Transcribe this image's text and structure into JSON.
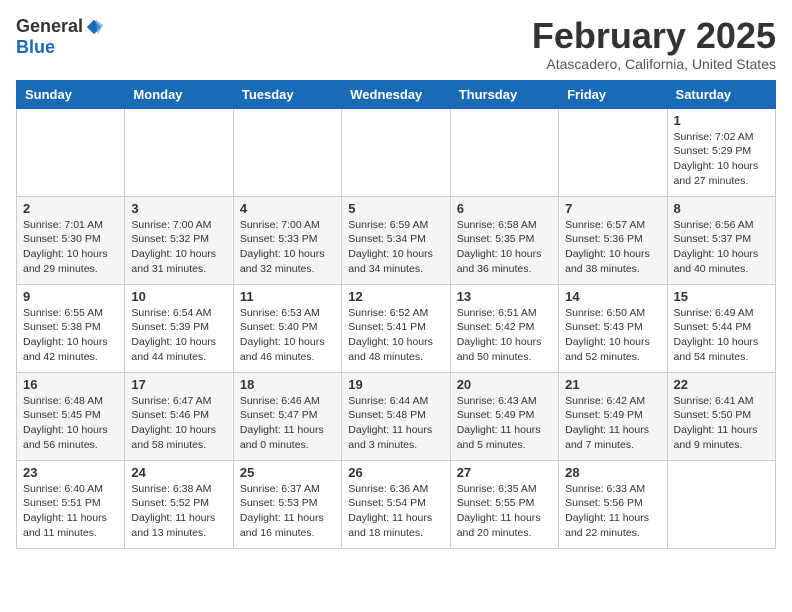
{
  "header": {
    "logo": {
      "general": "General",
      "blue": "Blue"
    },
    "title": "February 2025",
    "location": "Atascadero, California, United States"
  },
  "weekdays": [
    "Sunday",
    "Monday",
    "Tuesday",
    "Wednesday",
    "Thursday",
    "Friday",
    "Saturday"
  ],
  "weeks": [
    [
      {
        "day": "",
        "info": ""
      },
      {
        "day": "",
        "info": ""
      },
      {
        "day": "",
        "info": ""
      },
      {
        "day": "",
        "info": ""
      },
      {
        "day": "",
        "info": ""
      },
      {
        "day": "",
        "info": ""
      },
      {
        "day": "1",
        "info": "Sunrise: 7:02 AM\nSunset: 5:29 PM\nDaylight: 10 hours and 27 minutes."
      }
    ],
    [
      {
        "day": "2",
        "info": "Sunrise: 7:01 AM\nSunset: 5:30 PM\nDaylight: 10 hours and 29 minutes."
      },
      {
        "day": "3",
        "info": "Sunrise: 7:00 AM\nSunset: 5:32 PM\nDaylight: 10 hours and 31 minutes."
      },
      {
        "day": "4",
        "info": "Sunrise: 7:00 AM\nSunset: 5:33 PM\nDaylight: 10 hours and 32 minutes."
      },
      {
        "day": "5",
        "info": "Sunrise: 6:59 AM\nSunset: 5:34 PM\nDaylight: 10 hours and 34 minutes."
      },
      {
        "day": "6",
        "info": "Sunrise: 6:58 AM\nSunset: 5:35 PM\nDaylight: 10 hours and 36 minutes."
      },
      {
        "day": "7",
        "info": "Sunrise: 6:57 AM\nSunset: 5:36 PM\nDaylight: 10 hours and 38 minutes."
      },
      {
        "day": "8",
        "info": "Sunrise: 6:56 AM\nSunset: 5:37 PM\nDaylight: 10 hours and 40 minutes."
      }
    ],
    [
      {
        "day": "9",
        "info": "Sunrise: 6:55 AM\nSunset: 5:38 PM\nDaylight: 10 hours and 42 minutes."
      },
      {
        "day": "10",
        "info": "Sunrise: 6:54 AM\nSunset: 5:39 PM\nDaylight: 10 hours and 44 minutes."
      },
      {
        "day": "11",
        "info": "Sunrise: 6:53 AM\nSunset: 5:40 PM\nDaylight: 10 hours and 46 minutes."
      },
      {
        "day": "12",
        "info": "Sunrise: 6:52 AM\nSunset: 5:41 PM\nDaylight: 10 hours and 48 minutes."
      },
      {
        "day": "13",
        "info": "Sunrise: 6:51 AM\nSunset: 5:42 PM\nDaylight: 10 hours and 50 minutes."
      },
      {
        "day": "14",
        "info": "Sunrise: 6:50 AM\nSunset: 5:43 PM\nDaylight: 10 hours and 52 minutes."
      },
      {
        "day": "15",
        "info": "Sunrise: 6:49 AM\nSunset: 5:44 PM\nDaylight: 10 hours and 54 minutes."
      }
    ],
    [
      {
        "day": "16",
        "info": "Sunrise: 6:48 AM\nSunset: 5:45 PM\nDaylight: 10 hours and 56 minutes."
      },
      {
        "day": "17",
        "info": "Sunrise: 6:47 AM\nSunset: 5:46 PM\nDaylight: 10 hours and 58 minutes."
      },
      {
        "day": "18",
        "info": "Sunrise: 6:46 AM\nSunset: 5:47 PM\nDaylight: 11 hours and 0 minutes."
      },
      {
        "day": "19",
        "info": "Sunrise: 6:44 AM\nSunset: 5:48 PM\nDaylight: 11 hours and 3 minutes."
      },
      {
        "day": "20",
        "info": "Sunrise: 6:43 AM\nSunset: 5:49 PM\nDaylight: 11 hours and 5 minutes."
      },
      {
        "day": "21",
        "info": "Sunrise: 6:42 AM\nSunset: 5:49 PM\nDaylight: 11 hours and 7 minutes."
      },
      {
        "day": "22",
        "info": "Sunrise: 6:41 AM\nSunset: 5:50 PM\nDaylight: 11 hours and 9 minutes."
      }
    ],
    [
      {
        "day": "23",
        "info": "Sunrise: 6:40 AM\nSunset: 5:51 PM\nDaylight: 11 hours and 11 minutes."
      },
      {
        "day": "24",
        "info": "Sunrise: 6:38 AM\nSunset: 5:52 PM\nDaylight: 11 hours and 13 minutes."
      },
      {
        "day": "25",
        "info": "Sunrise: 6:37 AM\nSunset: 5:53 PM\nDaylight: 11 hours and 16 minutes."
      },
      {
        "day": "26",
        "info": "Sunrise: 6:36 AM\nSunset: 5:54 PM\nDaylight: 11 hours and 18 minutes."
      },
      {
        "day": "27",
        "info": "Sunrise: 6:35 AM\nSunset: 5:55 PM\nDaylight: 11 hours and 20 minutes."
      },
      {
        "day": "28",
        "info": "Sunrise: 6:33 AM\nSunset: 5:56 PM\nDaylight: 11 hours and 22 minutes."
      },
      {
        "day": "",
        "info": ""
      }
    ]
  ]
}
